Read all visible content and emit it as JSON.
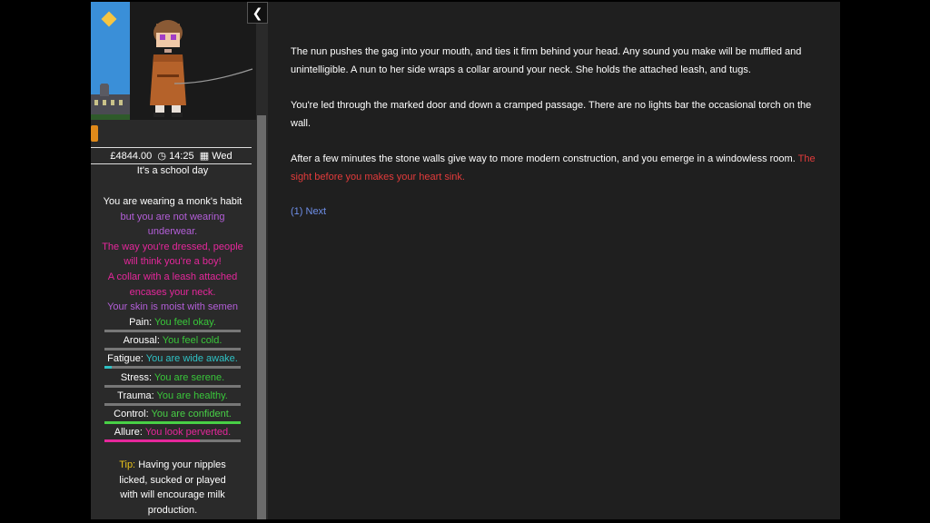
{
  "sidebar": {
    "collapse_glyph": "❮",
    "status": {
      "money": "£4844.00",
      "clock_icon": "clock-icon",
      "time": "14:25",
      "calendar_icon": "calendar-icon",
      "day": "Wed"
    },
    "school_day": "It's a school day",
    "clothing": {
      "wearing": "You are wearing a monk's habit",
      "underwear": "but you are not wearing underwear.",
      "dressed": "The way you're dressed, people will think you're a boy!",
      "collar": "A collar with a leash attached encases your neck.",
      "skin": "Your skin is moist with semen"
    },
    "stats": [
      {
        "label": "Pain:",
        "value": "You feel okay.",
        "color": "#39c73a",
        "fill": 0,
        "barcolor": "#39c73a"
      },
      {
        "label": "Arousal:",
        "value": "You feel cold.",
        "color": "#39c73a",
        "fill": 0,
        "barcolor": "#39c73a"
      },
      {
        "label": "Fatigue:",
        "value": "You are wide awake.",
        "color": "#2fc1c4",
        "fill": 0.05,
        "barcolor": "#2fc1c4"
      },
      {
        "label": "Stress:",
        "value": "You are serene.",
        "color": "#39c73a",
        "fill": 0,
        "barcolor": "#39c73a"
      },
      {
        "label": "Trauma:",
        "value": "You are healthy.",
        "color": "#39c73a",
        "fill": 0,
        "barcolor": "#39c73a"
      },
      {
        "label": "Control:",
        "value": "You are confident.",
        "color": "#48d046",
        "fill": 1,
        "barcolor": "#48d046"
      },
      {
        "label": "Allure:",
        "value": "You look perverted.",
        "color": "#e5279b",
        "fill": 0.7,
        "barcolor": "#e5279b"
      }
    ],
    "tip": {
      "label": "Tip:",
      "text": "Having your nipples licked, sucked or played with will encourage milk production."
    }
  },
  "main": {
    "p1": "The nun pushes the gag into your mouth, and ties it firm behind your head. Any sound you make will be muffled and unintelligible. A nun to her side wraps a collar around your neck. She holds the attached leash, and tugs.",
    "p2": "You're led through the marked door and down a cramped passage. There are no lights bar the occasional torch on the wall.",
    "p3_white": "After a few minutes the stone walls give way to more modern construction, and you emerge in a windowless room.",
    "p3_red": "The sight before you makes your heart sink.",
    "next": "(1) Next"
  }
}
